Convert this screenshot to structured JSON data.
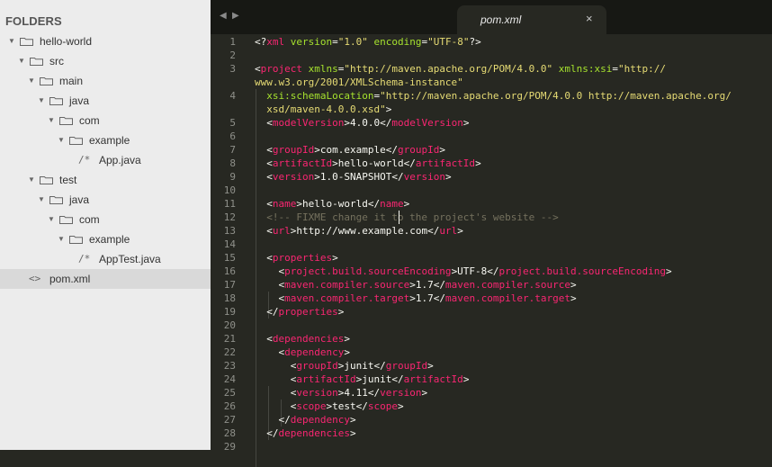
{
  "sidebar": {
    "title": "FOLDERS",
    "items": [
      {
        "label": "hello-world",
        "kind": "folder",
        "depth": 0,
        "expanded": true
      },
      {
        "label": "src",
        "kind": "folder",
        "depth": 1,
        "expanded": true
      },
      {
        "label": "main",
        "kind": "folder",
        "depth": 2,
        "expanded": true
      },
      {
        "label": "java",
        "kind": "folder",
        "depth": 3,
        "expanded": true
      },
      {
        "label": "com",
        "kind": "folder",
        "depth": 4,
        "expanded": true
      },
      {
        "label": "example",
        "kind": "folder",
        "depth": 5,
        "expanded": true
      },
      {
        "label": "App.java",
        "kind": "file",
        "glyph": "/*",
        "depth": 6
      },
      {
        "label": "test",
        "kind": "folder",
        "depth": 2,
        "expanded": true
      },
      {
        "label": "java",
        "kind": "folder",
        "depth": 3,
        "expanded": true
      },
      {
        "label": "com",
        "kind": "folder",
        "depth": 4,
        "expanded": true
      },
      {
        "label": "example",
        "kind": "folder",
        "depth": 5,
        "expanded": true
      },
      {
        "label": "AppTest.java",
        "kind": "file",
        "glyph": "/*",
        "depth": 6
      },
      {
        "label": "pom.xml",
        "kind": "file",
        "glyph": "<>",
        "depth": 1,
        "selected": true
      }
    ]
  },
  "tabs": {
    "nav_back": "◀",
    "nav_forward": "▶",
    "active_title": "pom.xml",
    "close_glyph": "×"
  },
  "editor": {
    "lines": [
      {
        "n": "1",
        "segs": [
          {
            "c": "p",
            "t": "<?"
          },
          {
            "c": "t",
            "t": "xml"
          },
          {
            "c": "a",
            "t": " version"
          },
          {
            "c": "p",
            "t": "="
          },
          {
            "c": "s",
            "t": "\"1.0\""
          },
          {
            "c": "a",
            "t": " encoding"
          },
          {
            "c": "p",
            "t": "="
          },
          {
            "c": "s",
            "t": "\"UTF-8\""
          },
          {
            "c": "p",
            "t": "?>"
          }
        ]
      },
      {
        "n": "2",
        "segs": []
      },
      {
        "n": "3",
        "segs": [
          {
            "c": "p",
            "t": "<"
          },
          {
            "c": "t",
            "t": "project"
          },
          {
            "c": "a",
            "t": " xmlns"
          },
          {
            "c": "p",
            "t": "="
          },
          {
            "c": "s",
            "t": "\"http://maven.apache.org/POM/4.0.0\""
          },
          {
            "c": "a",
            "t": " xmlns:xsi"
          },
          {
            "c": "p",
            "t": "="
          },
          {
            "c": "s",
            "t": "\"http://"
          }
        ]
      },
      {
        "n": "",
        "segs": [
          {
            "c": "s",
            "t": "www.w3.org/2001/XMLSchema-instance\""
          }
        ]
      },
      {
        "n": "4",
        "segs": [
          {
            "c": "p",
            "t": "  "
          },
          {
            "c": "a",
            "t": "xsi:schemaLocation"
          },
          {
            "c": "p",
            "t": "="
          },
          {
            "c": "s",
            "t": "\"http://maven.apache.org/POM/4.0.0 http://maven.apache.org/"
          }
        ]
      },
      {
        "n": "",
        "segs": [
          {
            "c": "s",
            "t": "  xsd/maven-4.0.0.xsd\""
          },
          {
            "c": "p",
            "t": ">"
          }
        ]
      },
      {
        "n": "5",
        "segs": [
          {
            "c": "p",
            "t": "  <"
          },
          {
            "c": "t",
            "t": "modelVersion"
          },
          {
            "c": "p",
            "t": ">4.0.0</"
          },
          {
            "c": "t",
            "t": "modelVersion"
          },
          {
            "c": "p",
            "t": ">"
          }
        ]
      },
      {
        "n": "6",
        "segs": []
      },
      {
        "n": "7",
        "segs": [
          {
            "c": "p",
            "t": "  <"
          },
          {
            "c": "t",
            "t": "groupId"
          },
          {
            "c": "p",
            "t": ">com.example</"
          },
          {
            "c": "t",
            "t": "groupId"
          },
          {
            "c": "p",
            "t": ">"
          }
        ]
      },
      {
        "n": "8",
        "segs": [
          {
            "c": "p",
            "t": "  <"
          },
          {
            "c": "t",
            "t": "artifactId"
          },
          {
            "c": "p",
            "t": ">hello-world</"
          },
          {
            "c": "t",
            "t": "artifactId"
          },
          {
            "c": "p",
            "t": ">"
          }
        ]
      },
      {
        "n": "9",
        "segs": [
          {
            "c": "p",
            "t": "  <"
          },
          {
            "c": "t",
            "t": "version"
          },
          {
            "c": "p",
            "t": ">1.0-SNAPSHOT</"
          },
          {
            "c": "t",
            "t": "version"
          },
          {
            "c": "p",
            "t": ">"
          }
        ]
      },
      {
        "n": "10",
        "segs": []
      },
      {
        "n": "11",
        "segs": [
          {
            "c": "p",
            "t": "  <"
          },
          {
            "c": "t",
            "t": "name"
          },
          {
            "c": "p",
            "t": ">hello-world</"
          },
          {
            "c": "t",
            "t": "name"
          },
          {
            "c": "p",
            "t": ">"
          }
        ]
      },
      {
        "n": "12",
        "segs": [
          {
            "c": "c",
            "t": "  <!-- FIXME change it to the project's website -->"
          }
        ]
      },
      {
        "n": "13",
        "segs": [
          {
            "c": "p",
            "t": "  <"
          },
          {
            "c": "t",
            "t": "url"
          },
          {
            "c": "p",
            "t": ">http://www.example.com</"
          },
          {
            "c": "t",
            "t": "url"
          },
          {
            "c": "p",
            "t": ">"
          }
        ]
      },
      {
        "n": "14",
        "segs": []
      },
      {
        "n": "15",
        "segs": [
          {
            "c": "p",
            "t": "  <"
          },
          {
            "c": "t",
            "t": "properties"
          },
          {
            "c": "p",
            "t": ">"
          }
        ]
      },
      {
        "n": "16",
        "segs": [
          {
            "c": "p",
            "t": "    <"
          },
          {
            "c": "t",
            "t": "project.build.sourceEncoding"
          },
          {
            "c": "p",
            "t": ">UTF-8</"
          },
          {
            "c": "t",
            "t": "project.build.sourceEncoding"
          },
          {
            "c": "p",
            "t": ">"
          }
        ]
      },
      {
        "n": "17",
        "segs": [
          {
            "c": "p",
            "t": "    <"
          },
          {
            "c": "t",
            "t": "maven.compiler.source"
          },
          {
            "c": "p",
            "t": ">1.7</"
          },
          {
            "c": "t",
            "t": "maven.compiler.source"
          },
          {
            "c": "p",
            "t": ">"
          }
        ]
      },
      {
        "n": "18",
        "segs": [
          {
            "c": "p",
            "t": "    <"
          },
          {
            "c": "t",
            "t": "maven.compiler.target"
          },
          {
            "c": "p",
            "t": ">1.7</"
          },
          {
            "c": "t",
            "t": "maven.compiler.target"
          },
          {
            "c": "p",
            "t": ">"
          }
        ]
      },
      {
        "n": "19",
        "segs": [
          {
            "c": "p",
            "t": "  </"
          },
          {
            "c": "t",
            "t": "properties"
          },
          {
            "c": "p",
            "t": ">"
          }
        ]
      },
      {
        "n": "20",
        "segs": []
      },
      {
        "n": "21",
        "segs": [
          {
            "c": "p",
            "t": "  <"
          },
          {
            "c": "t",
            "t": "dependencies"
          },
          {
            "c": "p",
            "t": ">"
          }
        ]
      },
      {
        "n": "22",
        "segs": [
          {
            "c": "p",
            "t": "    <"
          },
          {
            "c": "t",
            "t": "dependency"
          },
          {
            "c": "p",
            "t": ">"
          }
        ]
      },
      {
        "n": "23",
        "segs": [
          {
            "c": "p",
            "t": "      <"
          },
          {
            "c": "t",
            "t": "groupId"
          },
          {
            "c": "p",
            "t": ">junit</"
          },
          {
            "c": "t",
            "t": "groupId"
          },
          {
            "c": "p",
            "t": ">"
          }
        ]
      },
      {
        "n": "24",
        "segs": [
          {
            "c": "p",
            "t": "      <"
          },
          {
            "c": "t",
            "t": "artifactId"
          },
          {
            "c": "p",
            "t": ">junit</"
          },
          {
            "c": "t",
            "t": "artifactId"
          },
          {
            "c": "p",
            "t": ">"
          }
        ]
      },
      {
        "n": "25",
        "segs": [
          {
            "c": "p",
            "t": "      <"
          },
          {
            "c": "t",
            "t": "version"
          },
          {
            "c": "p",
            "t": ">4.11</"
          },
          {
            "c": "t",
            "t": "version"
          },
          {
            "c": "p",
            "t": ">"
          }
        ]
      },
      {
        "n": "26",
        "segs": [
          {
            "c": "p",
            "t": "      <"
          },
          {
            "c": "t",
            "t": "scope"
          },
          {
            "c": "p",
            "t": ">test</"
          },
          {
            "c": "t",
            "t": "scope"
          },
          {
            "c": "p",
            "t": ">"
          }
        ]
      },
      {
        "n": "27",
        "segs": [
          {
            "c": "p",
            "t": "    </"
          },
          {
            "c": "t",
            "t": "dependency"
          },
          {
            "c": "p",
            "t": ">"
          }
        ]
      },
      {
        "n": "28",
        "segs": [
          {
            "c": "p",
            "t": "  </"
          },
          {
            "c": "t",
            "t": "dependencies"
          },
          {
            "c": "p",
            "t": ">"
          }
        ]
      },
      {
        "n": "29",
        "segs": []
      }
    ]
  },
  "colors": {
    "editor_bg": "#272822",
    "tag": "#f92672",
    "attr": "#a6e22e",
    "string": "#e6db74",
    "comment": "#75715e",
    "text": "#f8f8f2",
    "sidebar_bg": "#ececec"
  }
}
